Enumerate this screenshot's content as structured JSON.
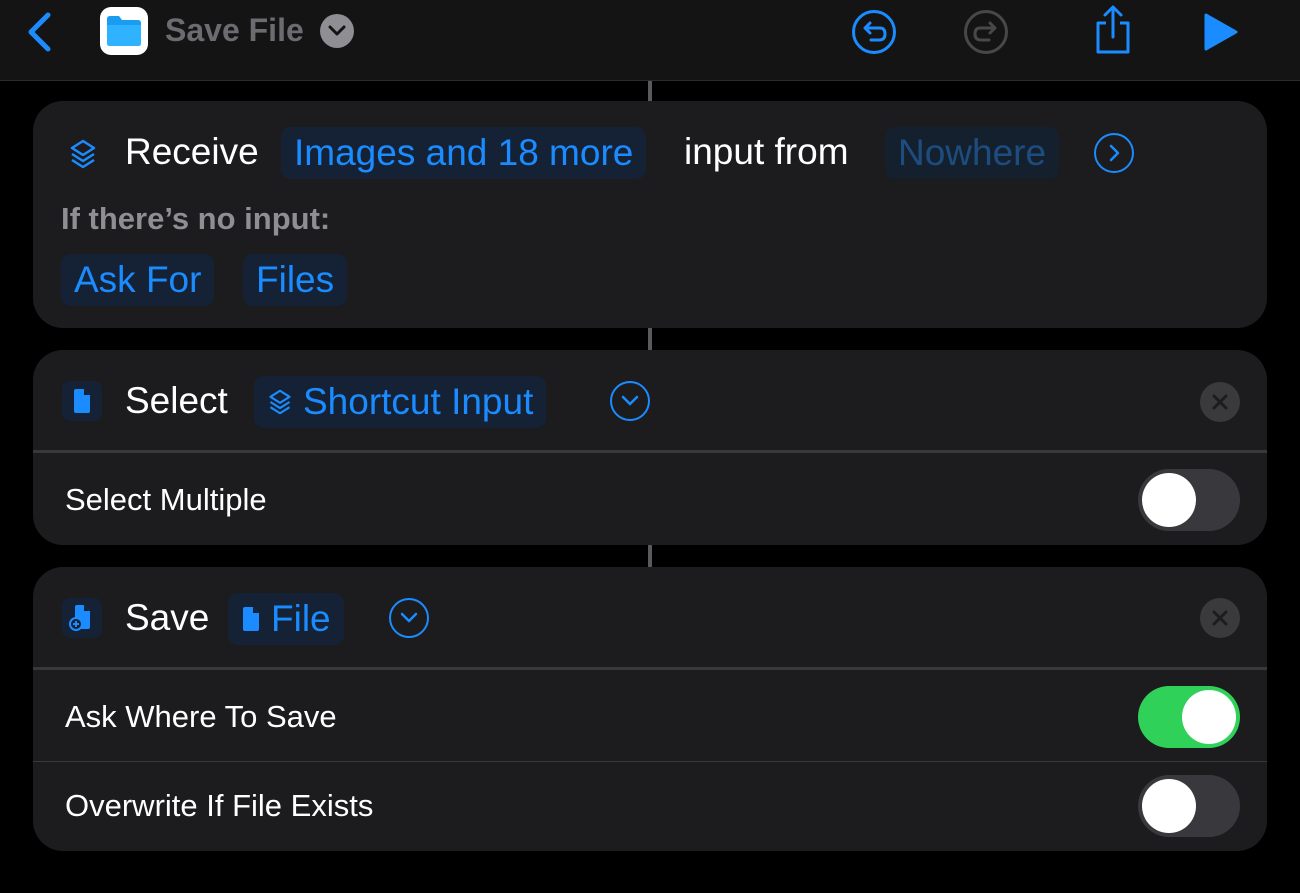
{
  "header": {
    "title": "Save File",
    "icons": {
      "back": "chevron-left-icon",
      "app": "files-folder-icon",
      "title_menu": "chevron-down-icon",
      "undo": "undo-icon",
      "redo": "redo-icon",
      "share": "share-icon",
      "run": "play-icon"
    },
    "redo_enabled": false
  },
  "receive_action": {
    "verb": "Receive",
    "types_chip": "Images and 18 more",
    "middle_text": "input from",
    "source_chip": "Nowhere",
    "no_input_label": "If there’s no input:",
    "no_input_options": [
      "Ask For",
      "Files"
    ],
    "icons": {
      "action": "shortcut-layers-icon",
      "expand": "chevron-right-circle-icon"
    }
  },
  "select_action": {
    "verb": "Select",
    "input_chip": "Shortcut Input",
    "options": [
      {
        "label": "Select Multiple",
        "enabled": false
      }
    ],
    "icons": {
      "action": "document-icon",
      "chip": "shortcut-layers-icon",
      "expand": "chevron-down-circle-icon",
      "remove": "close-icon"
    }
  },
  "save_action": {
    "verb": "Save",
    "input_chip": "File",
    "options": [
      {
        "label": "Ask Where To Save",
        "enabled": true
      },
      {
        "label": "Overwrite If File Exists",
        "enabled": false
      }
    ],
    "icons": {
      "action": "save-document-icon",
      "chip": "document-icon",
      "expand": "chevron-down-circle-icon",
      "remove": "close-icon"
    }
  },
  "colors": {
    "accent": "#1a8cff",
    "background": "#000000",
    "card": "#1c1c1e",
    "toggle_on": "#30d158",
    "toggle_off": "#39393d"
  }
}
